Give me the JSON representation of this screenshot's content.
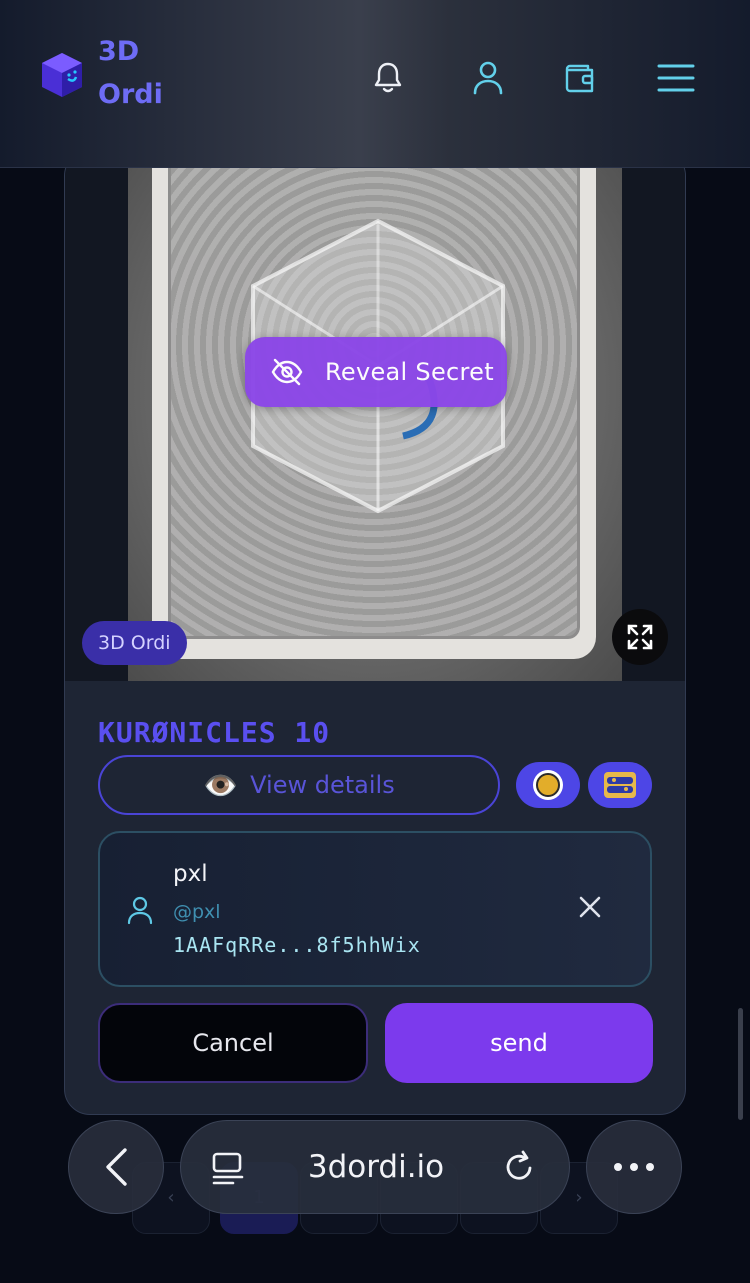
{
  "header": {
    "logo_line1": "3D",
    "logo_line2": "Ordi",
    "icons": [
      "bell-icon",
      "user-icon",
      "wallet-icon",
      "menu-icon"
    ]
  },
  "media": {
    "reveal_label": "Reveal Secret",
    "badge": "3D Ordi"
  },
  "item": {
    "title": "KURØNICLES 10",
    "details_label": "View details",
    "details_emoji": "👁️"
  },
  "recipient": {
    "name": "pxl",
    "handle": "@pxl",
    "address": "1AAFqRRe...8f5hhWix"
  },
  "actions": {
    "cancel_label": "Cancel",
    "send_label": "send"
  },
  "browser": {
    "url": "3dordi.io"
  },
  "pagination": {
    "prev": "‹",
    "next": "›",
    "active_page": "1"
  },
  "colors": {
    "accent": "#7c3aed",
    "brand": "#5a4ff0",
    "background": "#070b16"
  }
}
